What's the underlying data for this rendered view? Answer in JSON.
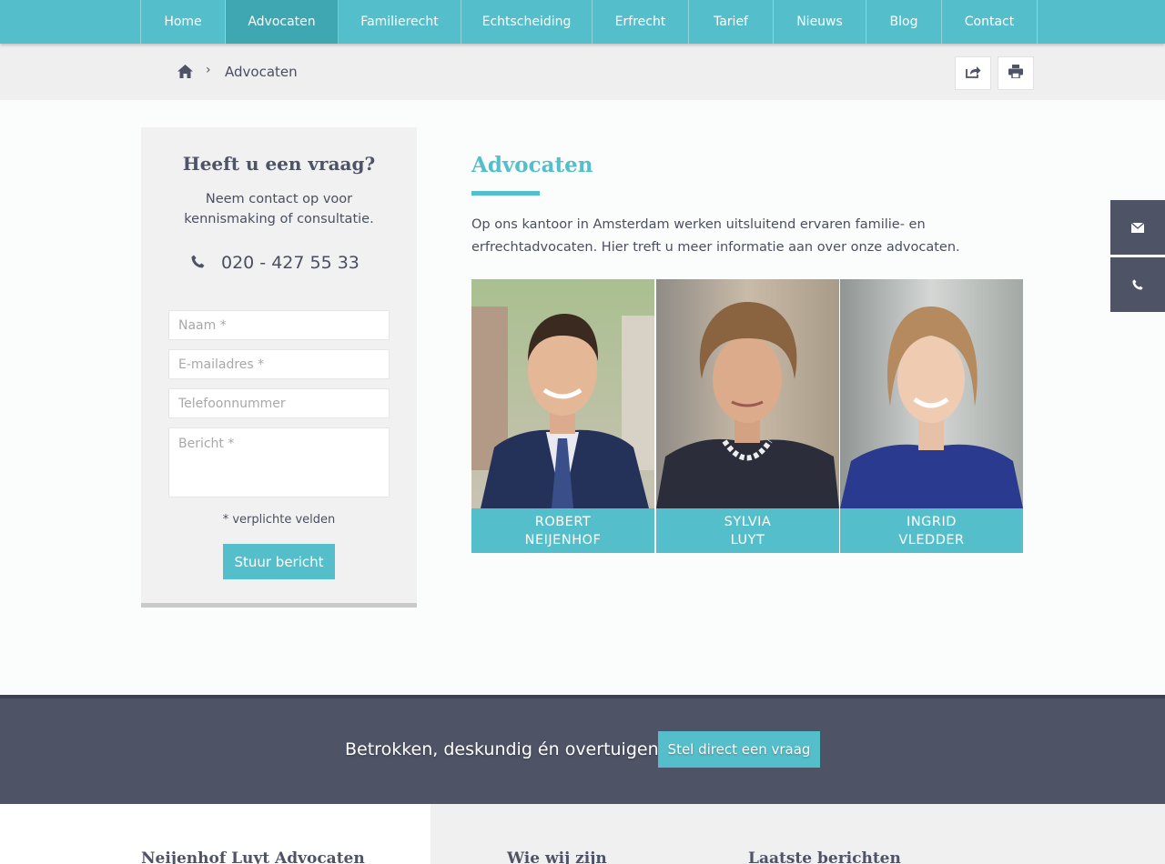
{
  "nav": {
    "items": [
      {
        "label": "Home"
      },
      {
        "label": "Advocaten",
        "active": true
      },
      {
        "label": "Familierecht"
      },
      {
        "label": "Echtscheiding"
      },
      {
        "label": "Erfrecht"
      },
      {
        "label": "Tarief"
      },
      {
        "label": "Nieuws"
      },
      {
        "label": "Blog"
      },
      {
        "label": "Contact"
      }
    ]
  },
  "breadcrumb": {
    "home_icon": "home-icon",
    "separator": "›",
    "current": "Advocaten"
  },
  "tools": {
    "share_icon": "share-icon",
    "print_icon": "print-icon"
  },
  "sidebar": {
    "title": "Heeft u een vraag?",
    "subtitle": "Neem contact op voor kennismaking of consultatie.",
    "phone": "020 - 427 55 33",
    "form": {
      "name_placeholder": "Naam *",
      "email_placeholder": "E-mailadres *",
      "phone_placeholder": "Telefoonnummer",
      "message_placeholder": "Bericht *",
      "required_note": "* verplichte velden",
      "submit_label": "Stuur bericht"
    }
  },
  "main": {
    "title": "Advocaten",
    "intro": "Op ons kantoor in Amsterdam werken uitsluitend ervaren familie- en erfrechtadvocaten. Hier treft u meer informatie aan over onze advocaten.",
    "lawyers": [
      {
        "first": "ROBERT",
        "last": "NEIJENHOF"
      },
      {
        "first": "SYLVIA",
        "last": "LUYT"
      },
      {
        "first": "INGRID",
        "last": "VLEDDER"
      }
    ]
  },
  "side_tabs": {
    "mail_icon": "envelope-icon",
    "phone_icon": "phone-icon"
  },
  "cta": {
    "text": "Betrokken, deskundig én overtuigend",
    "button": "Stel direct een vraag"
  },
  "footer": {
    "col1_title": "Neijenhof Luyt Advocaten",
    "col2_title": "Wie wij zijn",
    "col3_title": "Laatste berichten"
  },
  "colors": {
    "accent": "#54bfca",
    "dark": "#4e5366"
  }
}
